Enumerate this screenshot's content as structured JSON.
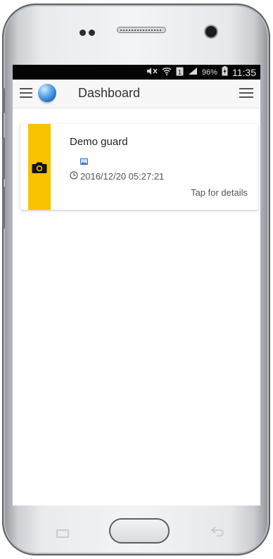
{
  "status_bar": {
    "battery_percent": "96%",
    "time": "11:35",
    "icons": [
      "mute-icon",
      "wifi-icon",
      "sim-icon",
      "signal-icon",
      "battery-icon"
    ]
  },
  "app_bar": {
    "title": "Dashboard",
    "icons": [
      "menu-icon",
      "globe-icon",
      "overflow-menu-icon"
    ]
  },
  "card": {
    "accent_color": "#f9c200",
    "icon": "camera-icon",
    "guard_name": "Demo guard",
    "attachment_icon": "image-icon",
    "timestamp": "2016/12/20 05:27:21",
    "timestamp_icon": "clock-icon",
    "action_text": "Tap for details"
  },
  "device_keys": [
    "recents-icon",
    "home-button",
    "back-icon"
  ]
}
